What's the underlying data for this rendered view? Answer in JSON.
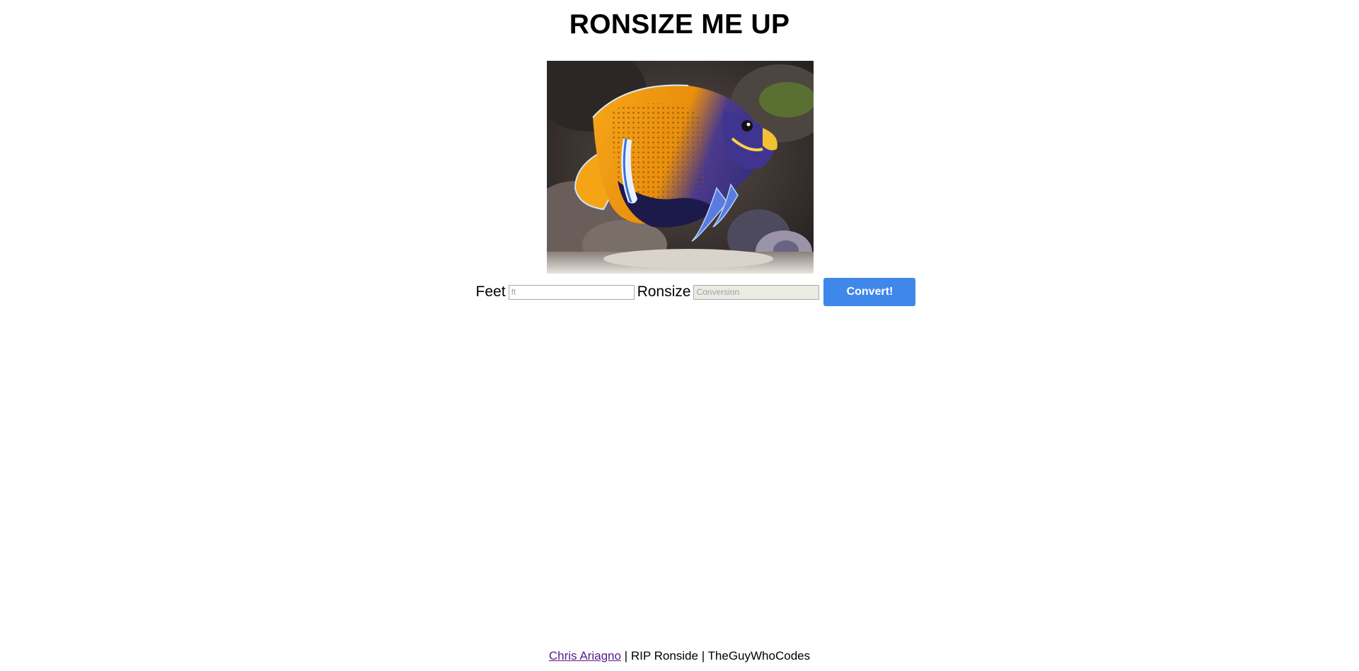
{
  "page": {
    "title": "RONSIZE ME UP"
  },
  "image": {
    "subject": "fish-image"
  },
  "form": {
    "feet_label": "Feet",
    "feet_placeholder": "ft",
    "feet_value": "",
    "ronsize_label": "Ronsize",
    "ronsize_placeholder": "Conversion",
    "ronsize_value": "",
    "convert_label": "Convert!"
  },
  "footer": {
    "author_link": "Chris Ariagno",
    "separator1": " | ",
    "tribute": "RIP Ronside",
    "separator2": " | ",
    "brand": "TheGuyWhoCodes"
  },
  "colors": {
    "button_bg": "#3f88e9",
    "link_visited": "#551a8b",
    "readonly_bg": "#ebebe4"
  }
}
